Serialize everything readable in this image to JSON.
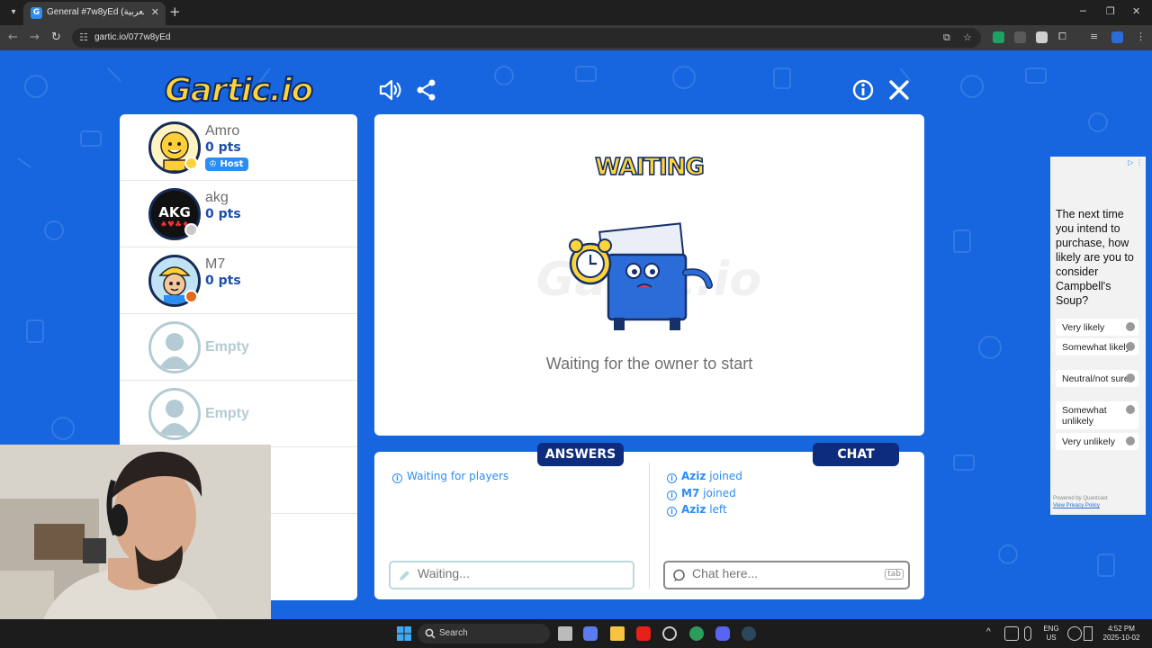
{
  "browser": {
    "tab_title": "General #7w8yEd (العربية) - Gartic.io",
    "url": "gartic.io/077w8yEd"
  },
  "game": {
    "logo": "Gartic.io",
    "status_title": "WAITING",
    "status_message": "Waiting for the owner to start",
    "players": [
      {
        "name": "Amro",
        "points": "0 pts",
        "badge": "Host"
      },
      {
        "name": "akg",
        "points": "0 pts"
      },
      {
        "name": "M7",
        "points": "0 pts"
      }
    ],
    "empty_slot_label": "Empty",
    "answers": {
      "label": "ANSWERS",
      "message": "Waiting for players",
      "placeholder": "Waiting..."
    },
    "chat": {
      "label": "CHAT",
      "messages": [
        {
          "user": "Aziz",
          "action": "joined"
        },
        {
          "user": "M7",
          "action": "joined"
        },
        {
          "user": "Aziz",
          "action": "left"
        }
      ],
      "placeholder": "Chat here...",
      "key_hint": "tab"
    }
  },
  "ad": {
    "question": "The next time you intend to purchase, how likely are you to consider Campbell's Soup?",
    "options": [
      "Very likely",
      "Somewhat likely",
      "Neutral/not sure",
      "Somewhat unlikely",
      "Very unlikely"
    ],
    "footer_powered": "Powered by Quantcast",
    "footer_link": "View Privacy Policy"
  },
  "taskbar": {
    "search_label": "Search",
    "lang_top": "ENG",
    "lang_bottom": "US",
    "time": "4:52 PM",
    "date": "2025-10-02"
  },
  "colors": {
    "game_bg": "#1765df",
    "accent_blue": "#2b8df2",
    "pill_navy": "#0e2c7e",
    "logo_yellow": "#ffd43b"
  }
}
